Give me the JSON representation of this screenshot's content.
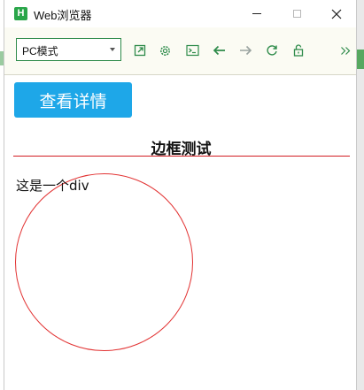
{
  "window": {
    "title": "Web浏览器",
    "app_icon_letter": "H"
  },
  "toolbar": {
    "mode_select_value": "PC模式",
    "icons": [
      "external-link-icon",
      "settings-icon",
      "terminal-icon",
      "back-arrow-icon",
      "forward-arrow-icon",
      "refresh-icon",
      "unlock-icon",
      "more-chevrons-icon"
    ],
    "accent_color": "#2e8b4a"
  },
  "page": {
    "button_label": "查看详情",
    "heading": "边框测试",
    "div_text": "这是一个div",
    "colors": {
      "button_bg": "#1ea7e8",
      "rule": "#d21d22",
      "circle_border": "#e23232"
    }
  }
}
